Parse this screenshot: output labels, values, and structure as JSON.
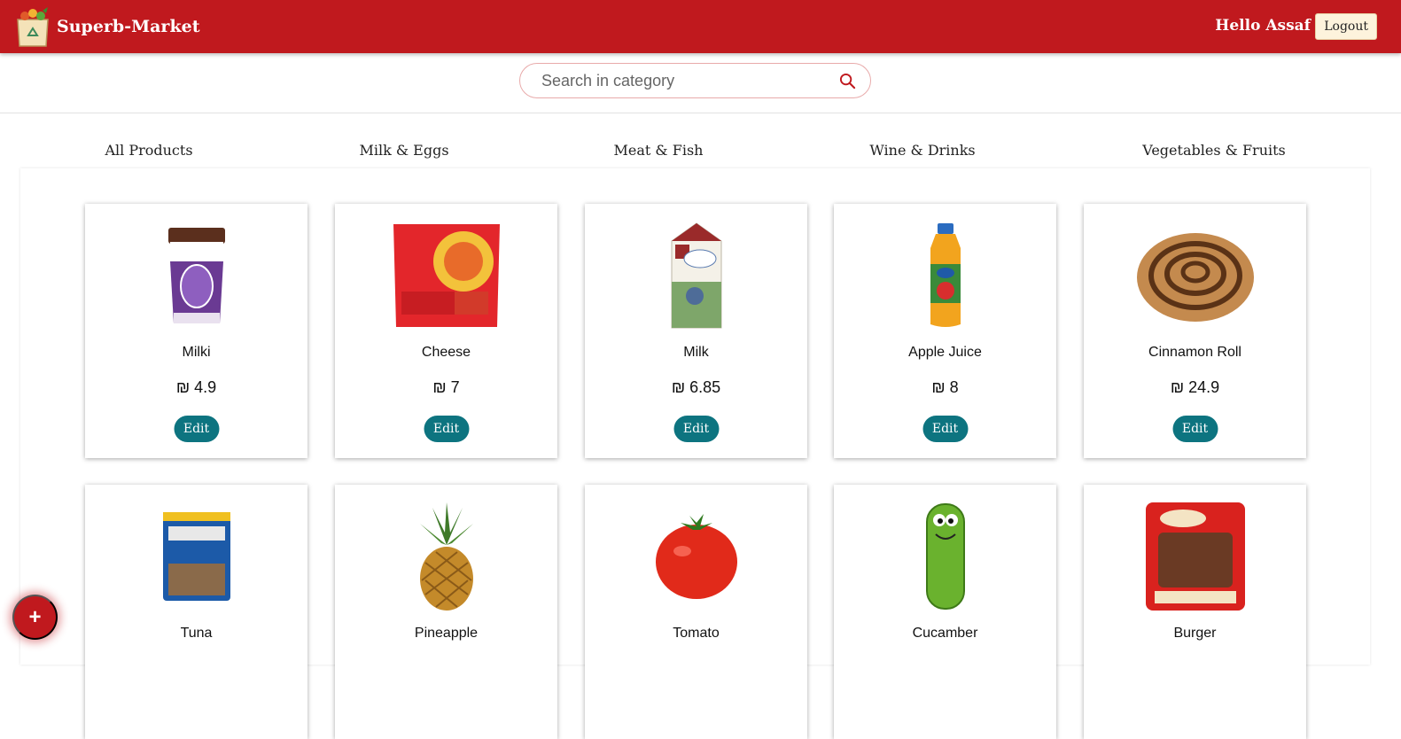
{
  "header": {
    "brand_name": "Superb-Market",
    "greeting": "Hello Assaf",
    "logout_label": "Logout",
    "colors": {
      "bar": "#c0191e",
      "logout_bg": "#fdf3dc"
    }
  },
  "search": {
    "placeholder": "Search in category",
    "icon": "search-icon"
  },
  "categories": [
    "All Products",
    "Milk & Eggs",
    "Meat & Fish",
    "Wine & Drinks",
    "Vegetables & Fruits"
  ],
  "products": [
    {
      "name": "Milki",
      "price": "₪ 4.9",
      "edit_label": "Edit"
    },
    {
      "name": "Cheese",
      "price": "₪ 7",
      "edit_label": "Edit"
    },
    {
      "name": "Milk",
      "price": "₪ 6.85",
      "edit_label": "Edit"
    },
    {
      "name": "Apple Juice",
      "price": "₪ 8",
      "edit_label": "Edit"
    },
    {
      "name": "Cinnamon Roll",
      "price": "₪ 24.9",
      "edit_label": "Edit"
    },
    {
      "name": "Tuna"
    },
    {
      "name": "Pineapple"
    },
    {
      "name": "Tomato"
    },
    {
      "name": "Cucamber"
    },
    {
      "name": "Burger"
    }
  ],
  "fab_label": "+",
  "accent_color": "#0d7480"
}
